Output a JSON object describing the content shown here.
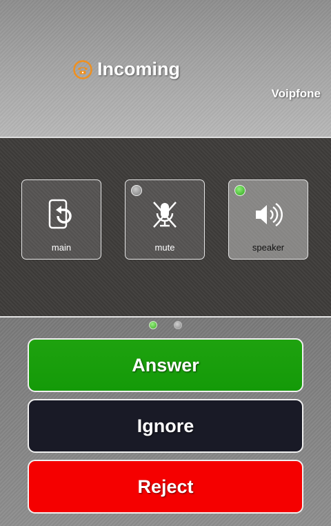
{
  "header": {
    "status": "Incoming",
    "account": "Voipfone",
    "icon": "phone-icon",
    "icon_color": "#f0901e"
  },
  "controls": [
    {
      "label": "main",
      "icon": "transfer-return-icon"
    },
    {
      "label": "mute",
      "icon": "mic-muted-icon",
      "state": "off"
    },
    {
      "label": "speaker",
      "icon": "speaker-icon",
      "state": "on"
    }
  ],
  "pager": {
    "pages": 2,
    "current": 1
  },
  "actions": {
    "answer": "Answer",
    "ignore": "Ignore",
    "reject": "Reject"
  },
  "colors": {
    "answer": "#16a00b",
    "ignore": "#191a26",
    "reject": "#f50000",
    "led_on": "#3aa81f"
  }
}
